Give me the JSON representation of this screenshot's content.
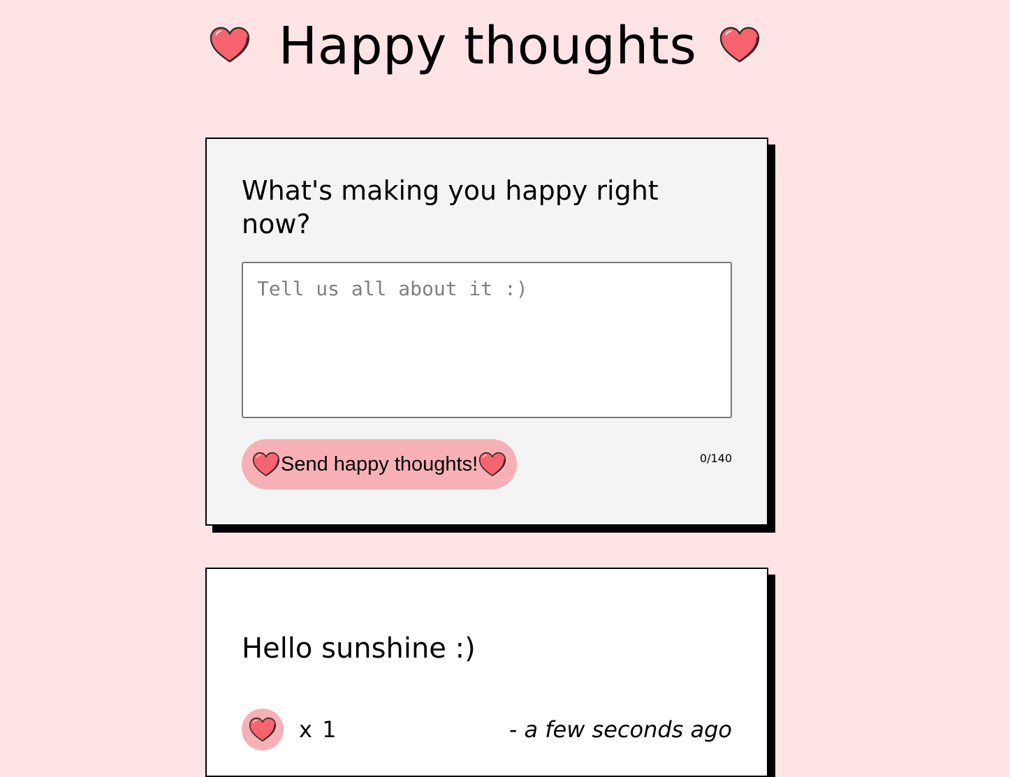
{
  "header": {
    "title": "Happy thoughts",
    "left_icon": "heart-icon",
    "right_icon": "heart-icon"
  },
  "form": {
    "question": "What's making you happy right now?",
    "textarea_value": "",
    "textarea_placeholder": "Tell us all about it :)",
    "send_label": "Send happy thoughts!",
    "send_icon": "heart-icon",
    "char_count": "0/140"
  },
  "thoughts": [
    {
      "message": "Hello sunshine :)",
      "like_icon": "heart-icon",
      "likes": "x 1",
      "time": "- a few seconds ago"
    }
  ],
  "colors": {
    "background": "#ffe4e6",
    "form_card": "#f4f4f4",
    "thought_card": "#ffffff",
    "button_pink": "#f7b1b6",
    "heart_fill": "#f76470",
    "shadow": "#000000"
  }
}
